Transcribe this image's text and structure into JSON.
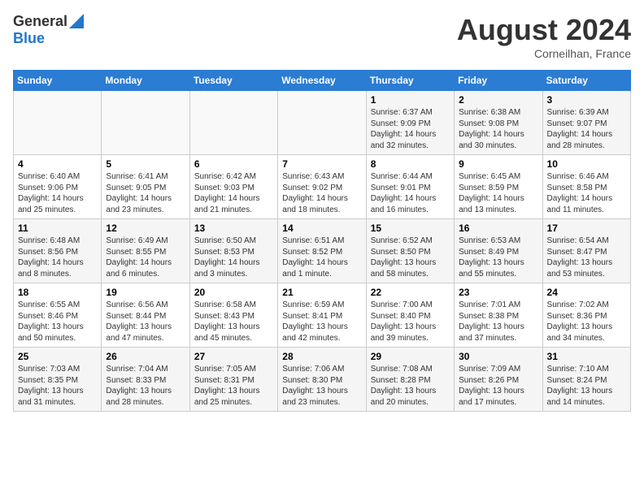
{
  "header": {
    "logo_line1": "General",
    "logo_line2": "Blue",
    "month": "August 2024",
    "location": "Corneilhan, France"
  },
  "days_of_week": [
    "Sunday",
    "Monday",
    "Tuesday",
    "Wednesday",
    "Thursday",
    "Friday",
    "Saturday"
  ],
  "weeks": [
    [
      {
        "day": "",
        "info": ""
      },
      {
        "day": "",
        "info": ""
      },
      {
        "day": "",
        "info": ""
      },
      {
        "day": "",
        "info": ""
      },
      {
        "day": "1",
        "info": "Sunrise: 6:37 AM\nSunset: 9:09 PM\nDaylight: 14 hours and 32 minutes."
      },
      {
        "day": "2",
        "info": "Sunrise: 6:38 AM\nSunset: 9:08 PM\nDaylight: 14 hours and 30 minutes."
      },
      {
        "day": "3",
        "info": "Sunrise: 6:39 AM\nSunset: 9:07 PM\nDaylight: 14 hours and 28 minutes."
      }
    ],
    [
      {
        "day": "4",
        "info": "Sunrise: 6:40 AM\nSunset: 9:06 PM\nDaylight: 14 hours and 25 minutes."
      },
      {
        "day": "5",
        "info": "Sunrise: 6:41 AM\nSunset: 9:05 PM\nDaylight: 14 hours and 23 minutes."
      },
      {
        "day": "6",
        "info": "Sunrise: 6:42 AM\nSunset: 9:03 PM\nDaylight: 14 hours and 21 minutes."
      },
      {
        "day": "7",
        "info": "Sunrise: 6:43 AM\nSunset: 9:02 PM\nDaylight: 14 hours and 18 minutes."
      },
      {
        "day": "8",
        "info": "Sunrise: 6:44 AM\nSunset: 9:01 PM\nDaylight: 14 hours and 16 minutes."
      },
      {
        "day": "9",
        "info": "Sunrise: 6:45 AM\nSunset: 8:59 PM\nDaylight: 14 hours and 13 minutes."
      },
      {
        "day": "10",
        "info": "Sunrise: 6:46 AM\nSunset: 8:58 PM\nDaylight: 14 hours and 11 minutes."
      }
    ],
    [
      {
        "day": "11",
        "info": "Sunrise: 6:48 AM\nSunset: 8:56 PM\nDaylight: 14 hours and 8 minutes."
      },
      {
        "day": "12",
        "info": "Sunrise: 6:49 AM\nSunset: 8:55 PM\nDaylight: 14 hours and 6 minutes."
      },
      {
        "day": "13",
        "info": "Sunrise: 6:50 AM\nSunset: 8:53 PM\nDaylight: 14 hours and 3 minutes."
      },
      {
        "day": "14",
        "info": "Sunrise: 6:51 AM\nSunset: 8:52 PM\nDaylight: 14 hours and 1 minute."
      },
      {
        "day": "15",
        "info": "Sunrise: 6:52 AM\nSunset: 8:50 PM\nDaylight: 13 hours and 58 minutes."
      },
      {
        "day": "16",
        "info": "Sunrise: 6:53 AM\nSunset: 8:49 PM\nDaylight: 13 hours and 55 minutes."
      },
      {
        "day": "17",
        "info": "Sunrise: 6:54 AM\nSunset: 8:47 PM\nDaylight: 13 hours and 53 minutes."
      }
    ],
    [
      {
        "day": "18",
        "info": "Sunrise: 6:55 AM\nSunset: 8:46 PM\nDaylight: 13 hours and 50 minutes."
      },
      {
        "day": "19",
        "info": "Sunrise: 6:56 AM\nSunset: 8:44 PM\nDaylight: 13 hours and 47 minutes."
      },
      {
        "day": "20",
        "info": "Sunrise: 6:58 AM\nSunset: 8:43 PM\nDaylight: 13 hours and 45 minutes."
      },
      {
        "day": "21",
        "info": "Sunrise: 6:59 AM\nSunset: 8:41 PM\nDaylight: 13 hours and 42 minutes."
      },
      {
        "day": "22",
        "info": "Sunrise: 7:00 AM\nSunset: 8:40 PM\nDaylight: 13 hours and 39 minutes."
      },
      {
        "day": "23",
        "info": "Sunrise: 7:01 AM\nSunset: 8:38 PM\nDaylight: 13 hours and 37 minutes."
      },
      {
        "day": "24",
        "info": "Sunrise: 7:02 AM\nSunset: 8:36 PM\nDaylight: 13 hours and 34 minutes."
      }
    ],
    [
      {
        "day": "25",
        "info": "Sunrise: 7:03 AM\nSunset: 8:35 PM\nDaylight: 13 hours and 31 minutes."
      },
      {
        "day": "26",
        "info": "Sunrise: 7:04 AM\nSunset: 8:33 PM\nDaylight: 13 hours and 28 minutes."
      },
      {
        "day": "27",
        "info": "Sunrise: 7:05 AM\nSunset: 8:31 PM\nDaylight: 13 hours and 25 minutes."
      },
      {
        "day": "28",
        "info": "Sunrise: 7:06 AM\nSunset: 8:30 PM\nDaylight: 13 hours and 23 minutes."
      },
      {
        "day": "29",
        "info": "Sunrise: 7:08 AM\nSunset: 8:28 PM\nDaylight: 13 hours and 20 minutes."
      },
      {
        "day": "30",
        "info": "Sunrise: 7:09 AM\nSunset: 8:26 PM\nDaylight: 13 hours and 17 minutes."
      },
      {
        "day": "31",
        "info": "Sunrise: 7:10 AM\nSunset: 8:24 PM\nDaylight: 13 hours and 14 minutes."
      }
    ]
  ]
}
